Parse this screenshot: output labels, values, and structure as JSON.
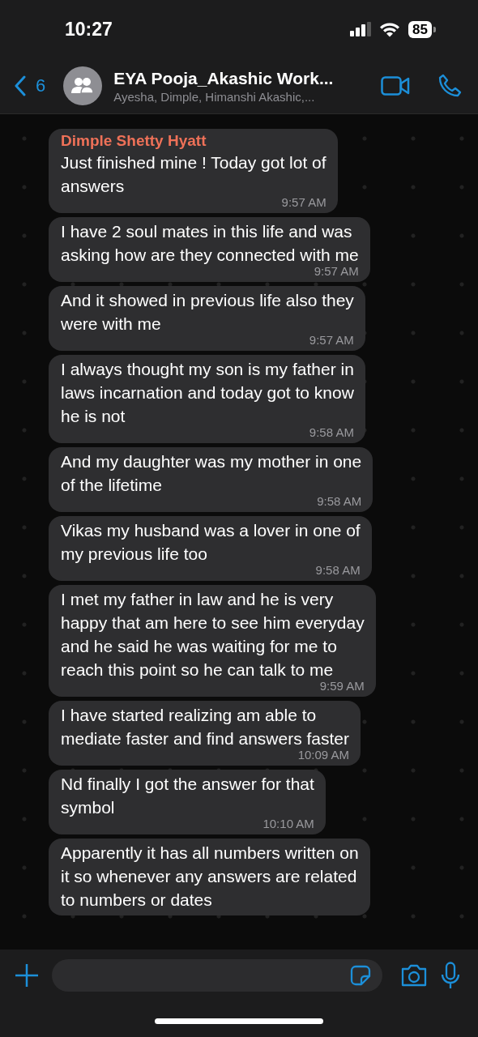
{
  "status_bar": {
    "time": "10:27",
    "battery": "85"
  },
  "header": {
    "back_count": "6",
    "title": "EYA Pooja_Akashic Work...",
    "subtitle": "Ayesha, Dimple, Himanshi Akashic,..."
  },
  "messages": [
    {
      "sender": {
        "name": "Dimple Shetty Hyatt",
        "color": "#ee7158"
      },
      "text": "Just finished mine ! Today got lot of\nanswers",
      "time": "9:57 AM"
    },
    {
      "text": "I have 2 soul mates in this life and was\nasking how are they connected with me",
      "time": "9:57 AM"
    },
    {
      "text": "And it showed in previous life also they\nwere with me",
      "time": "9:57 AM"
    },
    {
      "text": "I always thought my son is my father in\nlaws incarnation and today got to know\nhe is not",
      "time": "9:58 AM"
    },
    {
      "text": "And my daughter was my mother in one\nof the lifetime",
      "time": "9:58 AM"
    },
    {
      "text": "Vikas my husband was a lover in one of\nmy previous life too",
      "time": "9:58 AM"
    },
    {
      "text": "I met my father in law and he is very\nhappy that am here to see him everyday\nand he said he was waiting for me to\nreach this point so he can talk to me",
      "time": "9:59 AM"
    },
    {
      "text": "I have started realizing am able to\nmediate faster and find answers faster",
      "time": "10:09 AM"
    },
    {
      "text": "Nd finally I got the answer for that\nsymbol",
      "time": "10:10 AM"
    },
    {
      "text": "Apparently it has all numbers written on\nit so whenever any answers are related\nto numbers or dates"
    }
  ]
}
